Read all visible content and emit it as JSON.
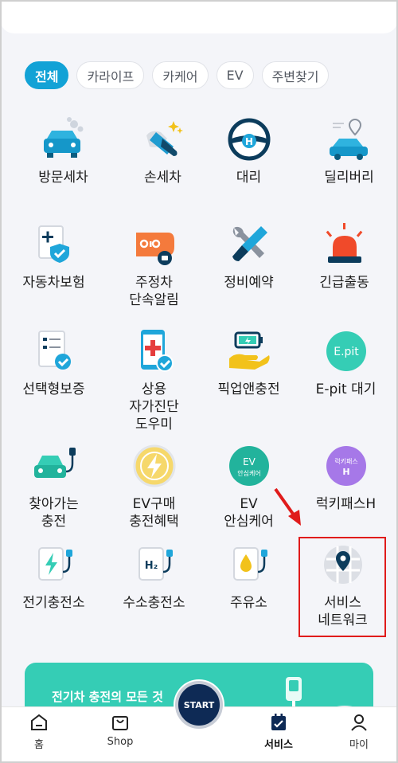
{
  "chips": [
    {
      "label": "전체"
    },
    {
      "label": "카라이프"
    },
    {
      "label": "카케어"
    },
    {
      "label": "EV"
    },
    {
      "label": "주변찾기"
    }
  ],
  "services": [
    {
      "label": "방문세차",
      "icon": "car-wash-icon"
    },
    {
      "label": "손세차",
      "icon": "hand-wash-icon"
    },
    {
      "label": "대리",
      "icon": "steering-wheel-icon"
    },
    {
      "label": "딜리버리",
      "icon": "delivery-car-icon"
    },
    {
      "label": "자동차보험",
      "icon": "insurance-icon"
    },
    {
      "label": "주정차\n단속알림",
      "icon": "parking-alert-icon"
    },
    {
      "label": "정비예약",
      "icon": "repair-tools-icon"
    },
    {
      "label": "긴급출동",
      "icon": "emergency-siren-icon"
    },
    {
      "label": "선택형보증",
      "icon": "warranty-checklist-icon"
    },
    {
      "label": "상용\n자가진단\n도우미",
      "icon": "self-diagnosis-icon"
    },
    {
      "label": "픽업앤충전",
      "icon": "pickup-charge-icon"
    },
    {
      "label": "E-pit 대기",
      "icon": "epit-icon"
    },
    {
      "label": "찾아가는\n충전",
      "icon": "mobile-charging-icon"
    },
    {
      "label": "EV구매\n충전혜택",
      "icon": "ev-benefit-icon"
    },
    {
      "label": "EV\n안심케어",
      "icon": "ev-care-icon"
    },
    {
      "label": "럭키패스H",
      "icon": "lucky-pass-icon"
    },
    {
      "label": "전기충전소",
      "icon": "ev-station-icon"
    },
    {
      "label": "수소충전소",
      "icon": "hydrogen-station-icon"
    },
    {
      "label": "주유소",
      "icon": "gas-station-icon"
    },
    {
      "label": "서비스\n네트워크",
      "icon": "service-network-icon"
    }
  ],
  "icon_text": {
    "epit": "E.pit",
    "ev_care_top": "EV",
    "ev_care_bottom": "안심케어",
    "lucky_top": "럭키패스",
    "lucky_bottom": "H",
    "h2": "H₂",
    "steering_h": "H"
  },
  "banner": {
    "text": "전기차 충전의 모든 것"
  },
  "tabbar": {
    "home": "홈",
    "shop": "Shop",
    "start": "START",
    "service": "서비스",
    "my": "마이"
  },
  "colors": {
    "accent": "#12a2d6",
    "highlight": "#e01b1b",
    "banner": "#35cdb5"
  }
}
